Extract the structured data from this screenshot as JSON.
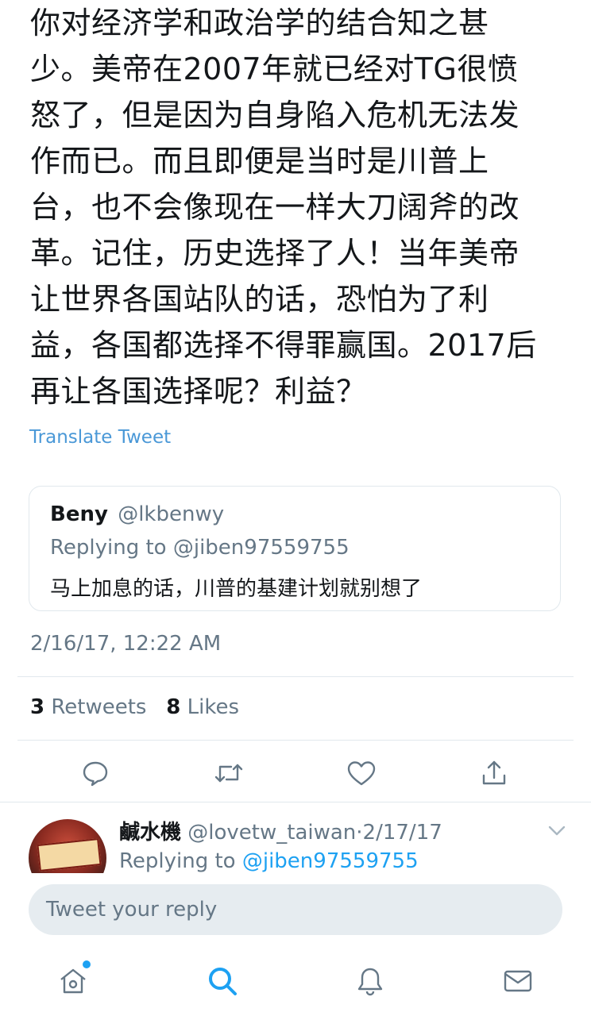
{
  "tweet": {
    "text": "你对经济学和政治学的结合知之甚\n少。美帝在2007年就已经对TG很愤\n怒了，但是因为自身陷入危机无法发\n作而已。而且即便是当时是川普上\n台，也不会像现在一样大刀阔斧的改\n革。记住，历史选择了人！当年美帝\n让世界各国站队的话，恐怕为了利\n益，各国都选择不得罪赢国。2017后\n再让各国选择呢？利益？",
    "translate_label": "Translate Tweet",
    "timestamp": "2/16/17, 12:22 AM",
    "retweets_count": "3",
    "retweets_label": "Retweets",
    "likes_count": "8",
    "likes_label": "Likes"
  },
  "quoted_tweet": {
    "name": "Beny",
    "handle": "@lkbenwy",
    "replying_to": "Replying to @jiben97559755",
    "text": "马上加息的话，川普的基建计划就别想了"
  },
  "actions": [
    {
      "name": "reply",
      "icon": "comment-icon"
    },
    {
      "name": "retweet",
      "icon": "retweet-icon"
    },
    {
      "name": "like",
      "icon": "heart-icon"
    },
    {
      "name": "share",
      "icon": "share-icon"
    }
  ],
  "reply": {
    "name": "鹹水機",
    "handle": "@lovetw_taiwan",
    "date_sep": "·",
    "date": "2/17/17",
    "replying_prefix": "Replying to",
    "replying_mention": "@jiben97559755"
  },
  "composer": {
    "placeholder": "Tweet your reply"
  },
  "tabbar": {
    "tabs": [
      {
        "name": "home",
        "icon": "home-icon",
        "has_notification_dot": true
      },
      {
        "name": "search",
        "icon": "search-icon",
        "active": true
      },
      {
        "name": "notifications",
        "icon": "bell-icon"
      },
      {
        "name": "messages",
        "icon": "mail-icon"
      }
    ]
  },
  "colors": {
    "accent": "#1da1f2",
    "link": "#4a98d7",
    "secondary_text": "#657786",
    "divider": "#e1e8ed",
    "input_bg": "#e6ecf0"
  }
}
